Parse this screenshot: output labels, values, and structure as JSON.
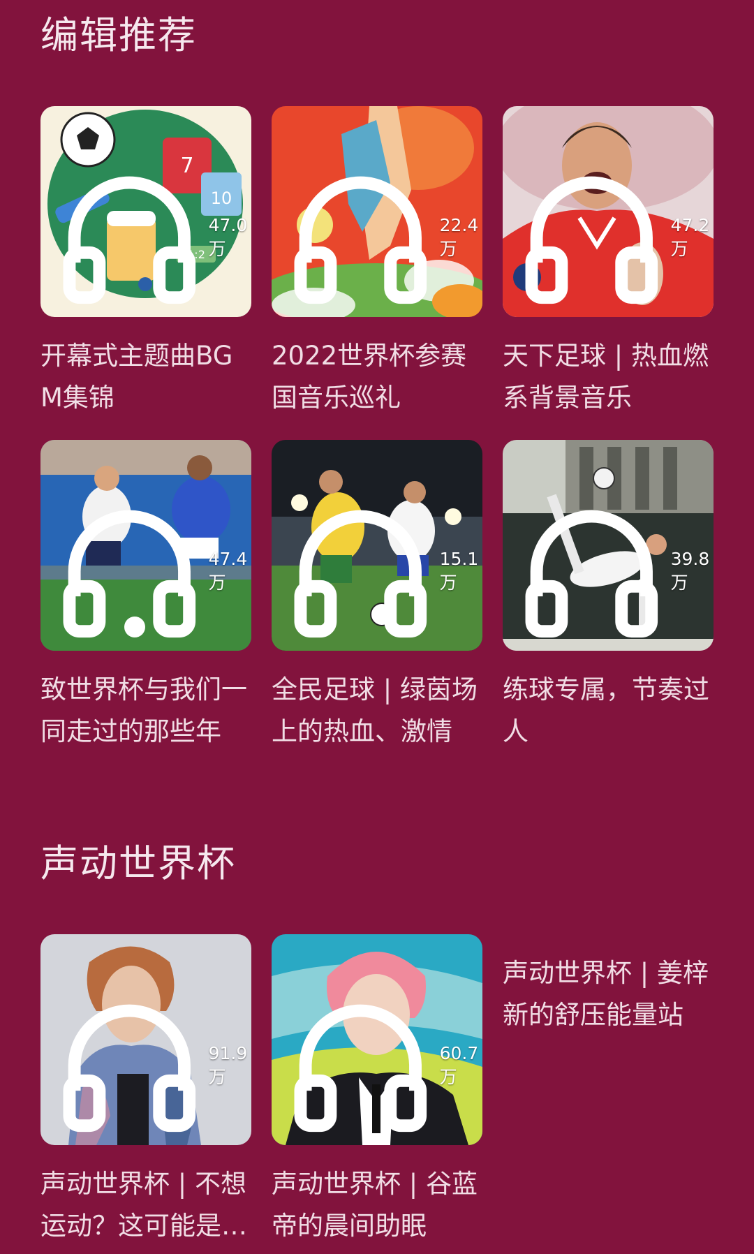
{
  "sections": [
    {
      "title": "编辑推荐",
      "cards": [
        {
          "title": "开幕式主题曲BGM集锦",
          "plays": "47.0万"
        },
        {
          "title": "2022世界杯参赛国音乐巡礼",
          "plays": "22.4万"
        },
        {
          "title": "天下足球 | 热血燃系背景音乐",
          "plays": "47.2万"
        },
        {
          "title": "致世界杯与我们一同走过的那些年",
          "plays": "47.4万"
        },
        {
          "title": "全民足球 | 绿茵场上的热血、激情",
          "plays": "15.1万"
        },
        {
          "title": "练球专属，节奏过人",
          "plays": "39.8万"
        }
      ]
    },
    {
      "title": "声动世界杯",
      "cards": [
        {
          "title": "声动世界杯 | 不想运动？这可能是最好的理由",
          "plays": "91.9万"
        },
        {
          "title": "声动世界杯 | 谷蓝帝的晨间助眠",
          "plays": "60.7万"
        },
        {
          "title": "声动世界杯 | 姜梓新的舒压能量站",
          "plays": ""
        }
      ]
    }
  ],
  "colors": {
    "background": "#82133d",
    "text": "#f1dde5"
  },
  "icons": {
    "play_count": "headphone-icon"
  }
}
